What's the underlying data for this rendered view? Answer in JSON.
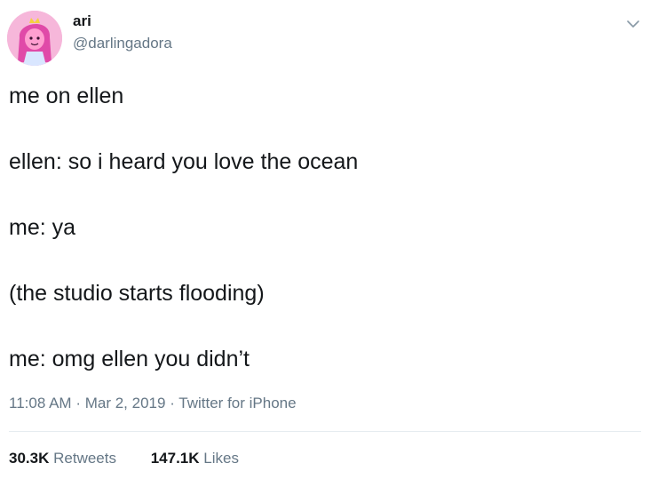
{
  "author": {
    "display_name": "ari",
    "handle": "@darlingadora",
    "avatar_icon": "princess-bubblegum-avatar"
  },
  "menu": {
    "icon": "chevron-down-icon"
  },
  "tweet": {
    "lines": [
      "me on ellen",
      "ellen: so i heard you love the ocean",
      "me: ya",
      "(the studio starts flooding)",
      "me: omg ellen you didn’t"
    ],
    "time": "11:08 AM",
    "date": "Mar 2, 2019",
    "source": "Twitter for iPhone",
    "separator": "·"
  },
  "stats": {
    "retweets_count": "30.3K",
    "retweets_label": "Retweets",
    "likes_count": "147.1K",
    "likes_label": "Likes"
  },
  "colors": {
    "text": "#14171a",
    "secondary": "#657786",
    "divider": "#e6ecf0",
    "avatar_bg": "#f7b3d9"
  }
}
